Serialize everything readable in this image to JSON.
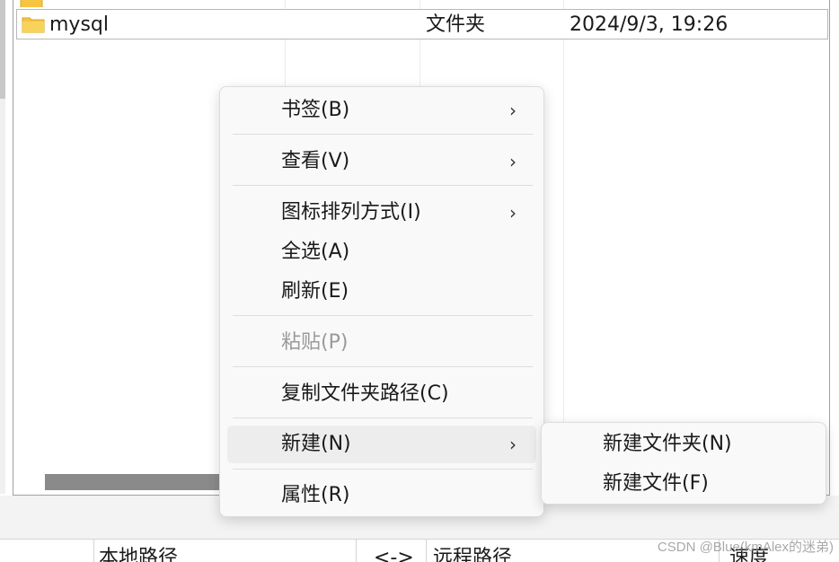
{
  "file_list": {
    "parent_entry": "..",
    "rows": [
      {
        "name": "mysql",
        "type": "文件夹",
        "modified": "2024/9/3, 19:26",
        "icon": "folder-icon"
      }
    ]
  },
  "context_menu": {
    "items": [
      {
        "label": "书签(B)",
        "has_submenu": true,
        "disabled": false
      },
      {
        "label": "查看(V)",
        "has_submenu": true,
        "disabled": false
      },
      {
        "label": "图标排列方式(I)",
        "has_submenu": true,
        "disabled": false
      },
      {
        "label": "全选(A)",
        "has_submenu": false,
        "disabled": false
      },
      {
        "label": "刷新(E)",
        "has_submenu": false,
        "disabled": false
      },
      {
        "label": "粘贴(P)",
        "has_submenu": false,
        "disabled": true
      },
      {
        "label": "复制文件夹路径(C)",
        "has_submenu": false,
        "disabled": false
      },
      {
        "label": "新建(N)",
        "has_submenu": true,
        "disabled": false,
        "highlighted": true
      },
      {
        "label": "属性(R)",
        "has_submenu": false,
        "disabled": false
      }
    ],
    "arrow_glyph": "›"
  },
  "submenu_new": {
    "items": [
      {
        "label": "新建文件夹(N)"
      },
      {
        "label": "新建文件(F)"
      }
    ]
  },
  "transfer_queue": {
    "col_local": "本地路径",
    "col_direction": "<->",
    "col_remote": "远程路径",
    "col_speed": "速度"
  },
  "watermark": "CSDN @Blue(kmAlex的迷弟)",
  "colors": {
    "menu_bg": "#f9f9f9",
    "menu_hover": "#ededed",
    "disabled_text": "#9a9a9a",
    "folder": "#f5c542"
  }
}
